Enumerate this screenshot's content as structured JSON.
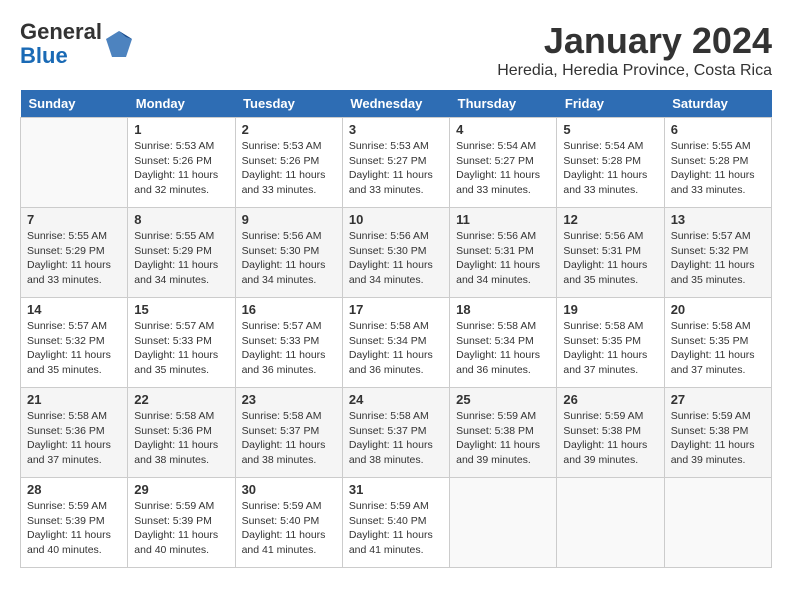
{
  "logo": {
    "general": "General",
    "blue": "Blue"
  },
  "title": "January 2024",
  "location": "Heredia, Heredia Province, Costa Rica",
  "days_of_week": [
    "Sunday",
    "Monday",
    "Tuesday",
    "Wednesday",
    "Thursday",
    "Friday",
    "Saturday"
  ],
  "weeks": [
    [
      {
        "day": "",
        "sunrise": "",
        "sunset": "",
        "daylight": ""
      },
      {
        "day": "1",
        "sunrise": "Sunrise: 5:53 AM",
        "sunset": "Sunset: 5:26 PM",
        "daylight": "Daylight: 11 hours and 32 minutes."
      },
      {
        "day": "2",
        "sunrise": "Sunrise: 5:53 AM",
        "sunset": "Sunset: 5:26 PM",
        "daylight": "Daylight: 11 hours and 33 minutes."
      },
      {
        "day": "3",
        "sunrise": "Sunrise: 5:53 AM",
        "sunset": "Sunset: 5:27 PM",
        "daylight": "Daylight: 11 hours and 33 minutes."
      },
      {
        "day": "4",
        "sunrise": "Sunrise: 5:54 AM",
        "sunset": "Sunset: 5:27 PM",
        "daylight": "Daylight: 11 hours and 33 minutes."
      },
      {
        "day": "5",
        "sunrise": "Sunrise: 5:54 AM",
        "sunset": "Sunset: 5:28 PM",
        "daylight": "Daylight: 11 hours and 33 minutes."
      },
      {
        "day": "6",
        "sunrise": "Sunrise: 5:55 AM",
        "sunset": "Sunset: 5:28 PM",
        "daylight": "Daylight: 11 hours and 33 minutes."
      }
    ],
    [
      {
        "day": "7",
        "sunrise": "Sunrise: 5:55 AM",
        "sunset": "Sunset: 5:29 PM",
        "daylight": "Daylight: 11 hours and 33 minutes."
      },
      {
        "day": "8",
        "sunrise": "Sunrise: 5:55 AM",
        "sunset": "Sunset: 5:29 PM",
        "daylight": "Daylight: 11 hours and 34 minutes."
      },
      {
        "day": "9",
        "sunrise": "Sunrise: 5:56 AM",
        "sunset": "Sunset: 5:30 PM",
        "daylight": "Daylight: 11 hours and 34 minutes."
      },
      {
        "day": "10",
        "sunrise": "Sunrise: 5:56 AM",
        "sunset": "Sunset: 5:30 PM",
        "daylight": "Daylight: 11 hours and 34 minutes."
      },
      {
        "day": "11",
        "sunrise": "Sunrise: 5:56 AM",
        "sunset": "Sunset: 5:31 PM",
        "daylight": "Daylight: 11 hours and 34 minutes."
      },
      {
        "day": "12",
        "sunrise": "Sunrise: 5:56 AM",
        "sunset": "Sunset: 5:31 PM",
        "daylight": "Daylight: 11 hours and 35 minutes."
      },
      {
        "day": "13",
        "sunrise": "Sunrise: 5:57 AM",
        "sunset": "Sunset: 5:32 PM",
        "daylight": "Daylight: 11 hours and 35 minutes."
      }
    ],
    [
      {
        "day": "14",
        "sunrise": "Sunrise: 5:57 AM",
        "sunset": "Sunset: 5:32 PM",
        "daylight": "Daylight: 11 hours and 35 minutes."
      },
      {
        "day": "15",
        "sunrise": "Sunrise: 5:57 AM",
        "sunset": "Sunset: 5:33 PM",
        "daylight": "Daylight: 11 hours and 35 minutes."
      },
      {
        "day": "16",
        "sunrise": "Sunrise: 5:57 AM",
        "sunset": "Sunset: 5:33 PM",
        "daylight": "Daylight: 11 hours and 36 minutes."
      },
      {
        "day": "17",
        "sunrise": "Sunrise: 5:58 AM",
        "sunset": "Sunset: 5:34 PM",
        "daylight": "Daylight: 11 hours and 36 minutes."
      },
      {
        "day": "18",
        "sunrise": "Sunrise: 5:58 AM",
        "sunset": "Sunset: 5:34 PM",
        "daylight": "Daylight: 11 hours and 36 minutes."
      },
      {
        "day": "19",
        "sunrise": "Sunrise: 5:58 AM",
        "sunset": "Sunset: 5:35 PM",
        "daylight": "Daylight: 11 hours and 37 minutes."
      },
      {
        "day": "20",
        "sunrise": "Sunrise: 5:58 AM",
        "sunset": "Sunset: 5:35 PM",
        "daylight": "Daylight: 11 hours and 37 minutes."
      }
    ],
    [
      {
        "day": "21",
        "sunrise": "Sunrise: 5:58 AM",
        "sunset": "Sunset: 5:36 PM",
        "daylight": "Daylight: 11 hours and 37 minutes."
      },
      {
        "day": "22",
        "sunrise": "Sunrise: 5:58 AM",
        "sunset": "Sunset: 5:36 PM",
        "daylight": "Daylight: 11 hours and 38 minutes."
      },
      {
        "day": "23",
        "sunrise": "Sunrise: 5:58 AM",
        "sunset": "Sunset: 5:37 PM",
        "daylight": "Daylight: 11 hours and 38 minutes."
      },
      {
        "day": "24",
        "sunrise": "Sunrise: 5:58 AM",
        "sunset": "Sunset: 5:37 PM",
        "daylight": "Daylight: 11 hours and 38 minutes."
      },
      {
        "day": "25",
        "sunrise": "Sunrise: 5:59 AM",
        "sunset": "Sunset: 5:38 PM",
        "daylight": "Daylight: 11 hours and 39 minutes."
      },
      {
        "day": "26",
        "sunrise": "Sunrise: 5:59 AM",
        "sunset": "Sunset: 5:38 PM",
        "daylight": "Daylight: 11 hours and 39 minutes."
      },
      {
        "day": "27",
        "sunrise": "Sunrise: 5:59 AM",
        "sunset": "Sunset: 5:38 PM",
        "daylight": "Daylight: 11 hours and 39 minutes."
      }
    ],
    [
      {
        "day": "28",
        "sunrise": "Sunrise: 5:59 AM",
        "sunset": "Sunset: 5:39 PM",
        "daylight": "Daylight: 11 hours and 40 minutes."
      },
      {
        "day": "29",
        "sunrise": "Sunrise: 5:59 AM",
        "sunset": "Sunset: 5:39 PM",
        "daylight": "Daylight: 11 hours and 40 minutes."
      },
      {
        "day": "30",
        "sunrise": "Sunrise: 5:59 AM",
        "sunset": "Sunset: 5:40 PM",
        "daylight": "Daylight: 11 hours and 41 minutes."
      },
      {
        "day": "31",
        "sunrise": "Sunrise: 5:59 AM",
        "sunset": "Sunset: 5:40 PM",
        "daylight": "Daylight: 11 hours and 41 minutes."
      },
      {
        "day": "",
        "sunrise": "",
        "sunset": "",
        "daylight": ""
      },
      {
        "day": "",
        "sunrise": "",
        "sunset": "",
        "daylight": ""
      },
      {
        "day": "",
        "sunrise": "",
        "sunset": "",
        "daylight": ""
      }
    ]
  ]
}
